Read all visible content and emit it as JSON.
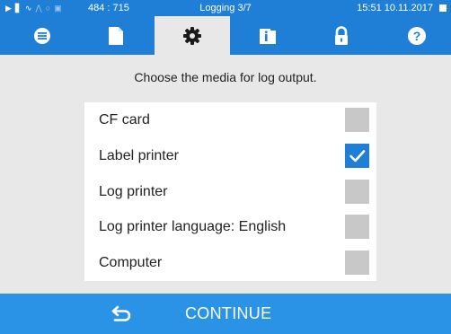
{
  "status_bar": {
    "coords": "484 : 715",
    "title": "Logging 3/7",
    "clock": "15:51  10.11.2017",
    "icons": [
      "play-icon",
      "book-icon",
      "steam-icon",
      "chart-icon",
      "clock-icon",
      "lock-icon"
    ]
  },
  "tabs": [
    {
      "icon": "menu-icon",
      "active": false
    },
    {
      "icon": "document-icon",
      "active": false
    },
    {
      "icon": "gear-icon",
      "active": true
    },
    {
      "icon": "info-card-icon",
      "active": false
    },
    {
      "icon": "lock-icon",
      "active": false
    },
    {
      "icon": "help-icon",
      "active": false
    }
  ],
  "instruction": "Choose the media for log output.",
  "options": [
    {
      "label": "CF card",
      "checked": false
    },
    {
      "label": "Label printer",
      "checked": true
    },
    {
      "label": "Log printer",
      "checked": false
    },
    {
      "label": "Log printer language: English",
      "checked": false
    },
    {
      "label": "Computer",
      "checked": false
    }
  ],
  "footer": {
    "continue_label": "CONTINUE",
    "icon": "back-arrow-icon"
  },
  "colors": {
    "accent": "#1f7fd6",
    "footer": "#2a93e6",
    "background": "#e8e8e8",
    "checkbox_off": "#c8c8c8"
  }
}
